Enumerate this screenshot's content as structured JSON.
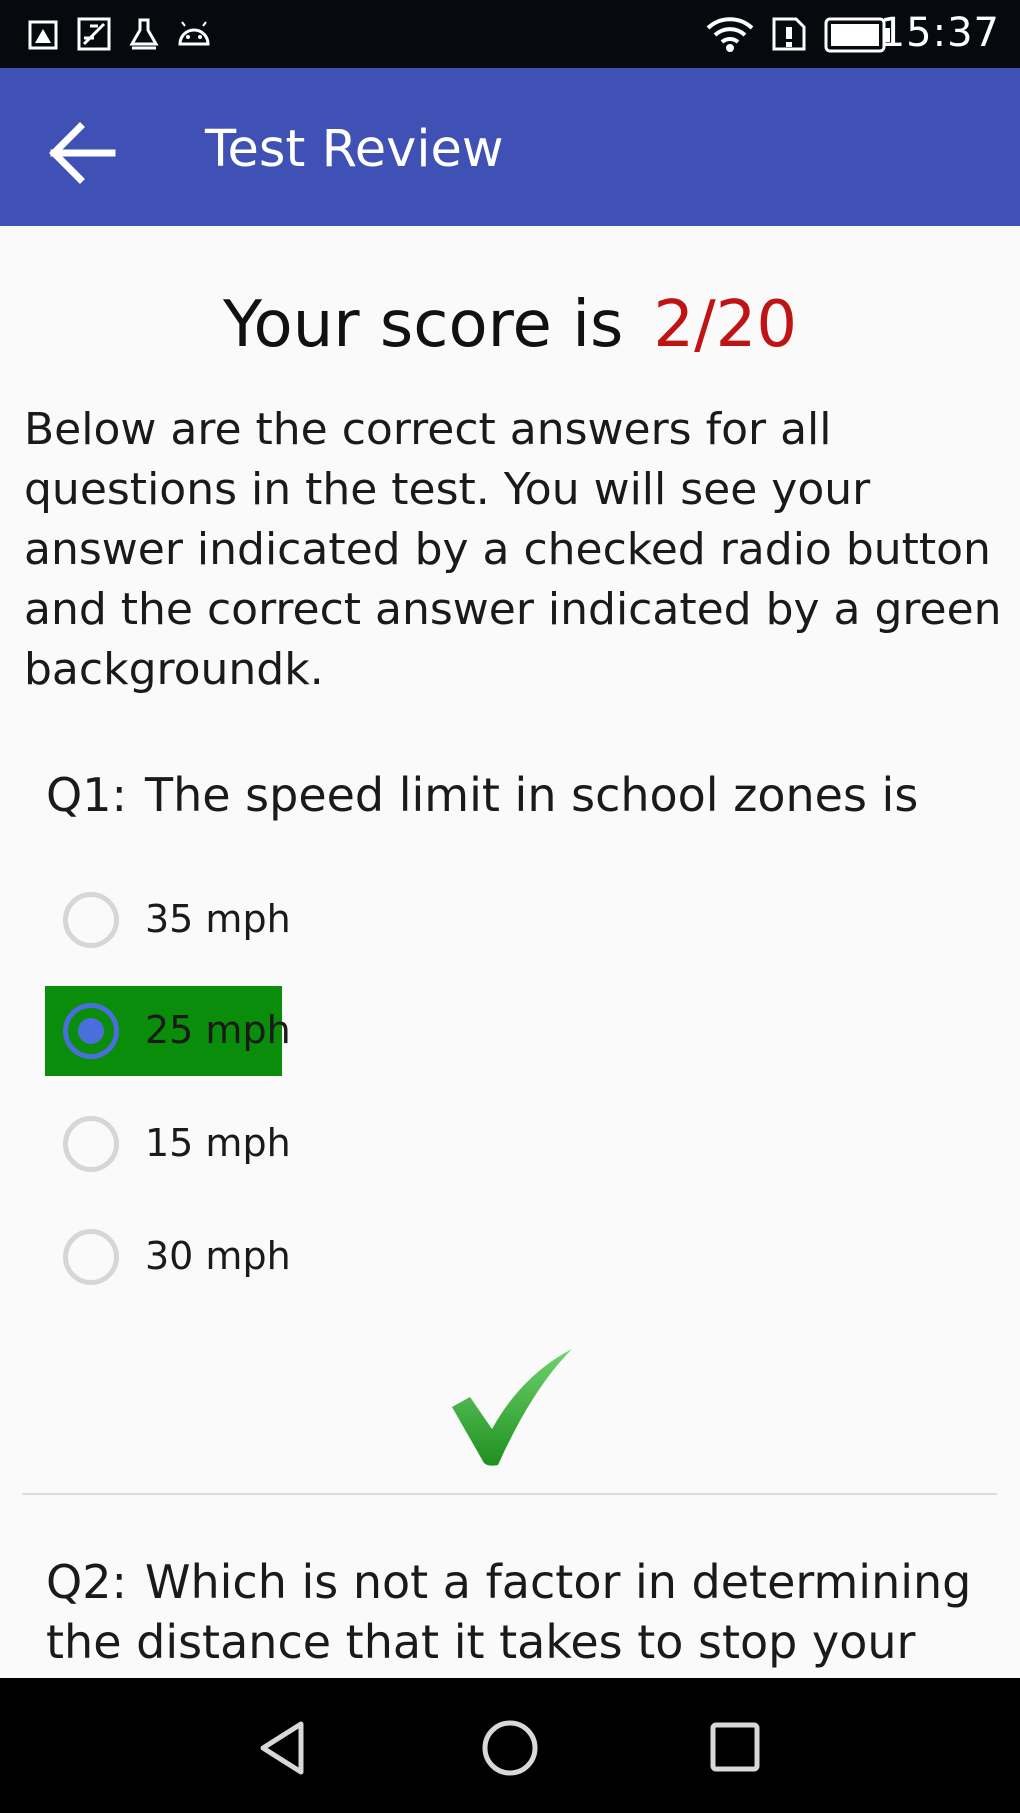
{
  "status_bar": {
    "time": "15:37",
    "left_icons": [
      "notification-icon",
      "image-icon",
      "cleaner-icon",
      "android-icon"
    ],
    "right_icons": [
      "wifi-icon",
      "sim-icon",
      "battery-icon"
    ]
  },
  "app_bar": {
    "title": "Test Review",
    "back_icon": "arrow-left-icon",
    "color": "#3f51b5"
  },
  "score": {
    "label": "Your score is",
    "value": "2/20",
    "value_color": "#c01414"
  },
  "intro_text": "Below are the correct answers for all questions in the test. You will see your answer indicated by a checked radio button and the correct answer indicated by a green backgroundk.",
  "questions": [
    {
      "prefix": "Q1:",
      "text": "The speed limit in school zones is",
      "options": [
        {
          "label": "35 mph",
          "checked": false,
          "correct": false
        },
        {
          "label": "25 mph",
          "checked": true,
          "correct": true
        },
        {
          "label": "15 mph",
          "checked": false,
          "correct": false
        },
        {
          "label": "30 mph",
          "checked": false,
          "correct": false
        }
      ],
      "result_icon": "checkmark-icon"
    },
    {
      "prefix": "Q2:",
      "text": "Which is not a factor in determining the distance that it takes to stop your"
    }
  ],
  "colors": {
    "correct_bg": "#0a8d0a",
    "radio_checked": "#4a6fdc",
    "checkmark": "#2eaa2e"
  },
  "nav_bar": [
    "back-triangle-icon",
    "home-circle-icon",
    "recents-square-icon"
  ]
}
